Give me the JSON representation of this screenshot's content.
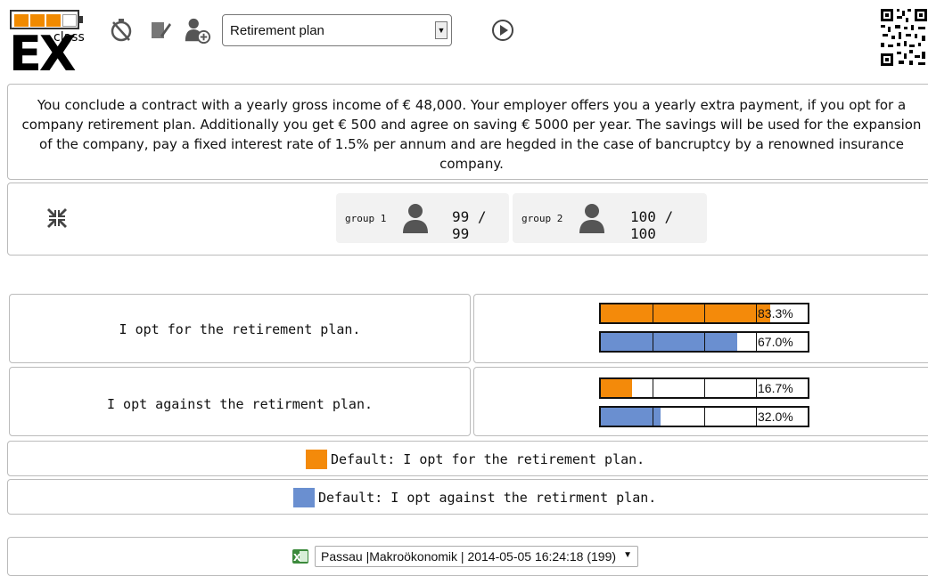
{
  "app": {
    "logo_text": "EX",
    "logo_superscript": "class"
  },
  "toolbar": {
    "icons": [
      "stopwatch-off-icon",
      "notepad-edit-icon",
      "add-user-icon",
      "play-circle-icon"
    ],
    "scenario_select": {
      "value": "Retirement plan"
    }
  },
  "question": {
    "text": "You conclude a contract with a yearly gross income of € 48,000. Your employer offers you a yearly extra payment, if you opt for a company retirement plan. Additionally you get € 500 and agree on saving € 5000 per year. The savings will be used for the expansion of the company, pay a fixed interest rate of 1.5% per annum and are hegded in the case of bancruptcy by a renowned insurance company."
  },
  "groups": [
    {
      "label": "group 1",
      "count": "99 / 99"
    },
    {
      "label": "group 2",
      "count": "100 / 100"
    }
  ],
  "colors": {
    "group1": "#f48a0a",
    "group2": "#6a8fd0"
  },
  "answers": [
    {
      "label": "I opt for the retirement plan.",
      "results": [
        {
          "series": "group1",
          "percent": 83.3,
          "label": "83.3%"
        },
        {
          "series": "group2",
          "percent": 67.0,
          "label": "67.0%"
        }
      ]
    },
    {
      "label": "I opt against the retirment plan.",
      "results": [
        {
          "series": "group1",
          "percent": 16.7,
          "label": "16.7%"
        },
        {
          "series": "group2",
          "percent": 32.0,
          "label": "32.0%"
        }
      ]
    }
  ],
  "legend": [
    {
      "series": "group1",
      "label": "Default:  I opt for the retirement plan."
    },
    {
      "series": "group2",
      "label": "Default:  I opt against the retirment plan."
    }
  ],
  "footer": {
    "session_select": {
      "value": "Passau |Makroökonomik | 2014-05-05 16:24:18 (199)"
    }
  }
}
